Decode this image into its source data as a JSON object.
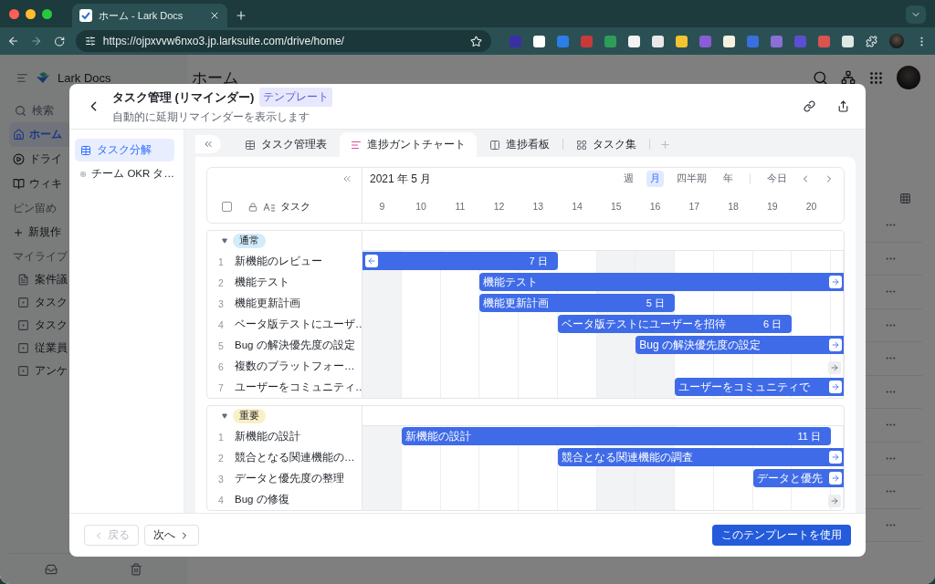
{
  "browser": {
    "tab_title": "ホーム - Lark Docs",
    "url": "https://ojpxvvw6nxo3.jp.larksuite.com/drive/home/"
  },
  "app": {
    "brand": "Lark Docs",
    "page_title": "ホーム",
    "search": {
      "placeholder": "検索"
    },
    "nav": [
      {
        "label": "ホーム",
        "selected": true
      },
      {
        "label": "ドライ",
        "selected": false
      },
      {
        "label": "ウィキ",
        "selected": false
      }
    ],
    "pinned_heading": "ピン留め",
    "new_item": "新規作",
    "library_heading": "マイライブ",
    "library": [
      {
        "label": "案件議",
        "kind": "doc"
      },
      {
        "label": "タスク",
        "kind": "base"
      },
      {
        "label": "タスク",
        "kind": "base"
      },
      {
        "label": "従業員",
        "kind": "base"
      },
      {
        "label": "アンケ",
        "kind": "base"
      }
    ]
  },
  "modal": {
    "title": "タスク管理 (リマインダー)",
    "badge": "テンプレート",
    "subtitle": "自動的に延期リマインダーを表示します",
    "templates": [
      {
        "label": "タスク分解",
        "selected": true
      },
      {
        "label": "チーム OKR タ…",
        "selected": false
      }
    ],
    "tabs": [
      {
        "label": "タスク管理表",
        "kind": "table",
        "selected": false
      },
      {
        "label": "進捗ガントチャート",
        "kind": "gantt",
        "selected": true
      },
      {
        "label": "進捗看板",
        "kind": "kanban",
        "selected": false
      },
      {
        "label": "タスク集",
        "kind": "gallery",
        "selected": false
      }
    ],
    "gantt": {
      "month": "2021 年 5 月",
      "field_label": "タスク",
      "select_all": {
        "checked": false
      },
      "scales": [
        {
          "label": "週",
          "selected": false
        },
        {
          "label": "月",
          "selected": true
        },
        {
          "label": "四半期",
          "selected": false
        },
        {
          "label": "年",
          "selected": false
        }
      ],
      "today": "今日",
      "days": [
        {
          "label": "9",
          "weekend": true
        },
        {
          "label": "10",
          "weekend": false
        },
        {
          "label": "11",
          "weekend": false
        },
        {
          "label": "12",
          "weekend": false
        },
        {
          "label": "13",
          "weekend": false
        },
        {
          "label": "14",
          "weekend": false
        },
        {
          "label": "15",
          "weekend": true
        },
        {
          "label": "16",
          "weekend": true
        },
        {
          "label": "17",
          "weekend": false
        },
        {
          "label": "18",
          "weekend": false
        },
        {
          "label": "19",
          "weekend": false
        },
        {
          "label": "20",
          "weekend": false
        }
      ],
      "groups": [
        {
          "tag": "通常",
          "color": "#d3ecfa",
          "expanded": true,
          "rows": [
            {
              "number": "1",
              "task": "新機能のレビュー",
              "bar": {
                "kind": "span",
                "duration": "7 日",
                "continues_left": true,
                "continues_right": false
              }
            },
            {
              "number": "2",
              "task": "機能テスト",
              "bar": {
                "kind": "span",
                "label": "機能テスト",
                "continues_left": false,
                "continues_right": true
              }
            },
            {
              "number": "3",
              "task": "機能更新計画",
              "bar": {
                "kind": "span",
                "label": "機能更新計画",
                "duration": "5 日",
                "continues_left": false,
                "continues_right": false
              }
            },
            {
              "number": "4",
              "task": "ベータ版テストにユーザ…",
              "bar": {
                "kind": "span",
                "label": "ベータ版テストにユーザーを招待",
                "duration": "6 日",
                "continues_left": false,
                "continues_right": false
              }
            },
            {
              "number": "5",
              "task": "Bug の解決優先度の設定",
              "bar": {
                "kind": "span",
                "label": "Bug の解決優先度の設定",
                "continues_left": false,
                "continues_right": true
              }
            },
            {
              "number": "6",
              "task": "複数のプラットフォー…",
              "bar": {
                "kind": "offscreen"
              }
            },
            {
              "number": "7",
              "task": "ユーザーをコミュニティ…",
              "bar": {
                "kind": "span",
                "label": "ユーザーをコミュニティで",
                "continues_left": false,
                "continues_right": true
              }
            }
          ]
        },
        {
          "tag": "重要",
          "color": "#fbefc6",
          "expanded": true,
          "rows": [
            {
              "number": "1",
              "task": "新機能の設計",
              "bar": {
                "kind": "span",
                "label": "新機能の設計",
                "duration": "11 日",
                "continues_left": false,
                "continues_right": false
              }
            },
            {
              "number": "2",
              "task": "競合となる関連機能の…",
              "bar": {
                "kind": "span",
                "label": "競合となる関連機能の調査",
                "continues_left": false,
                "continues_right": true
              }
            },
            {
              "number": "3",
              "task": "データと優先度の整理",
              "bar": {
                "kind": "span",
                "label": "データと優先",
                "continues_left": false,
                "continues_right": true
              }
            },
            {
              "number": "4",
              "task": "Bug の修復",
              "bar": {
                "kind": "offscreen"
              }
            }
          ]
        }
      ]
    },
    "footer": {
      "back": {
        "label": "戻る",
        "disabled": true
      },
      "next": {
        "label": "次へ",
        "disabled": false
      },
      "use": "このテンプレートを使用"
    }
  }
}
